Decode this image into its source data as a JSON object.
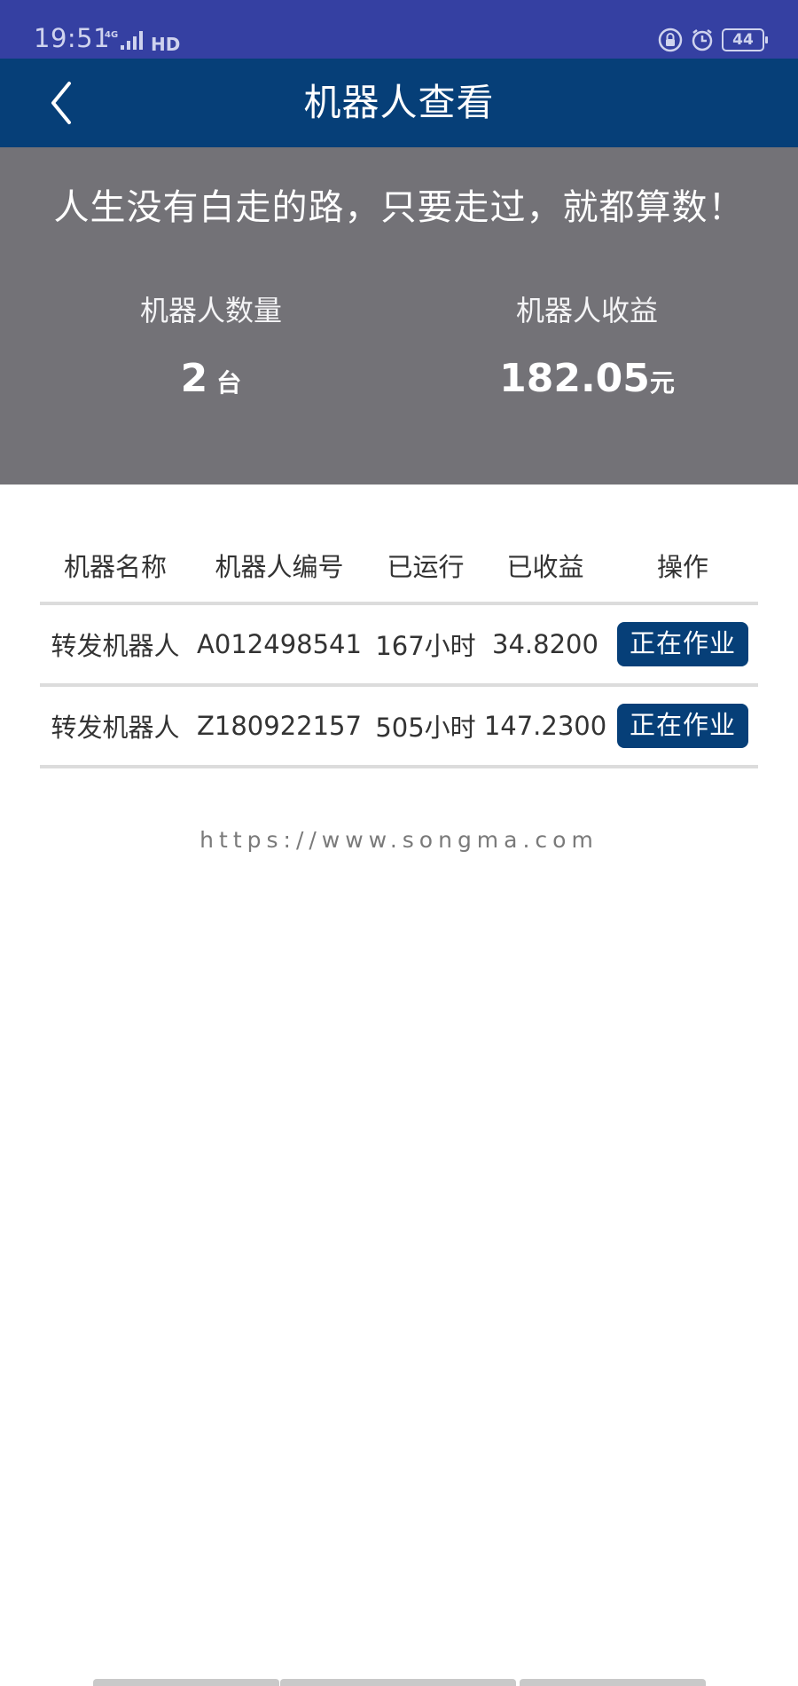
{
  "status_bar": {
    "time": "19:51",
    "network": "4G",
    "hd_label": "HD",
    "battery": "44",
    "icons": [
      "lock-rotation-icon",
      "alarm-icon",
      "battery-icon",
      "signal-icon"
    ]
  },
  "nav": {
    "title": "机器人查看",
    "back_icon": "chevron-left-icon"
  },
  "summary": {
    "motto": "人生没有白走的路，只要走过，就都算数！",
    "robot_count_label": "机器人数量",
    "robot_count_value": "2",
    "robot_count_unit": "台",
    "robot_income_label": "机器人收益",
    "robot_income_value": "182.05",
    "robot_income_unit": "元"
  },
  "table": {
    "headers": [
      "机器名称",
      "机器人编号",
      "已运行",
      "已收益",
      "操作"
    ],
    "rows": [
      {
        "name": "转发机器人",
        "code": "A012498541",
        "runtime": "167小时",
        "income": "34.8200",
        "action": "正在作业"
      },
      {
        "name": "转发机器人",
        "code": "Z180922157",
        "runtime": "505小时",
        "income": "147.2300",
        "action": "正在作业"
      }
    ]
  },
  "footer": {
    "url": "https://www.songma.com"
  },
  "colors": {
    "status_bar": "#3540a2",
    "nav_bar": "#063f78",
    "summary_panel": "#737277",
    "button": "#063f78"
  }
}
